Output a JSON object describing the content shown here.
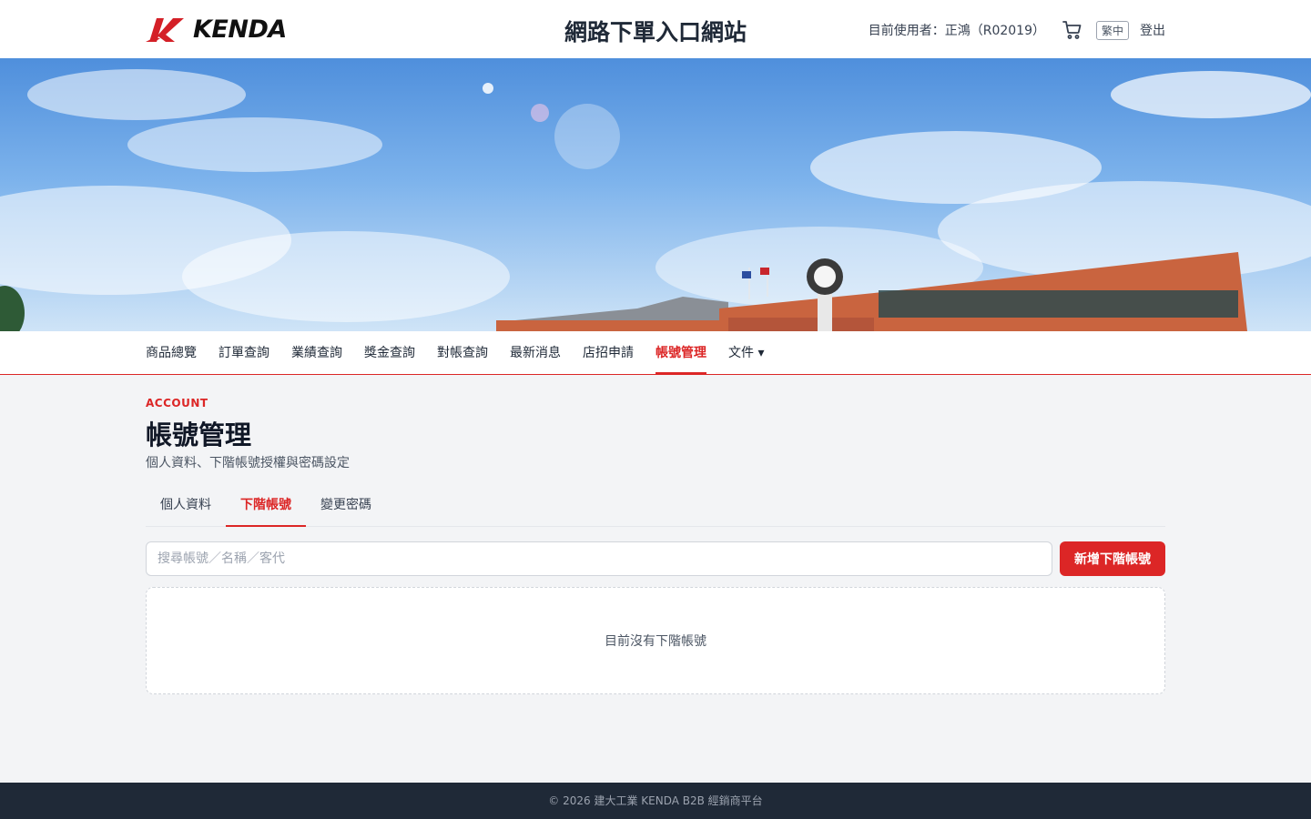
{
  "header": {
    "logo_text": "KENDA",
    "site_title": "網路下單入口網站",
    "user_label": "目前使用者：正鴻（R02019）",
    "lang_label": "繁中",
    "logout_label": "登出"
  },
  "nav": {
    "items": [
      {
        "label": "商品總覽",
        "active": false
      },
      {
        "label": "訂單查詢",
        "active": false
      },
      {
        "label": "業績查詢",
        "active": false
      },
      {
        "label": "獎金查詢",
        "active": false
      },
      {
        "label": "對帳查詢",
        "active": false
      },
      {
        "label": "最新消息",
        "active": false
      },
      {
        "label": "店招申請",
        "active": false
      },
      {
        "label": "帳號管理",
        "active": true
      },
      {
        "label": "文件 ▾",
        "active": false
      }
    ]
  },
  "page": {
    "eyebrow": "ACCOUNT",
    "title": "帳號管理",
    "subtitle": "個人資料、下階帳號授權與密碼設定"
  },
  "tabs": [
    {
      "label": "個人資料",
      "active": false
    },
    {
      "label": "下階帳號",
      "active": true
    },
    {
      "label": "變更密碼",
      "active": false
    }
  ],
  "search": {
    "placeholder": "搜尋帳號／名稱／客代",
    "value": ""
  },
  "actions": {
    "add_label": "新增下階帳號"
  },
  "empty_state": {
    "message": "目前沒有下階帳號"
  },
  "footer": {
    "text": "© 2026 建大工業 KENDA B2B 經銷商平台"
  },
  "colors": {
    "accent": "#dc2626",
    "footer_bg": "#1f2937",
    "page_bg": "#f3f4f6"
  }
}
